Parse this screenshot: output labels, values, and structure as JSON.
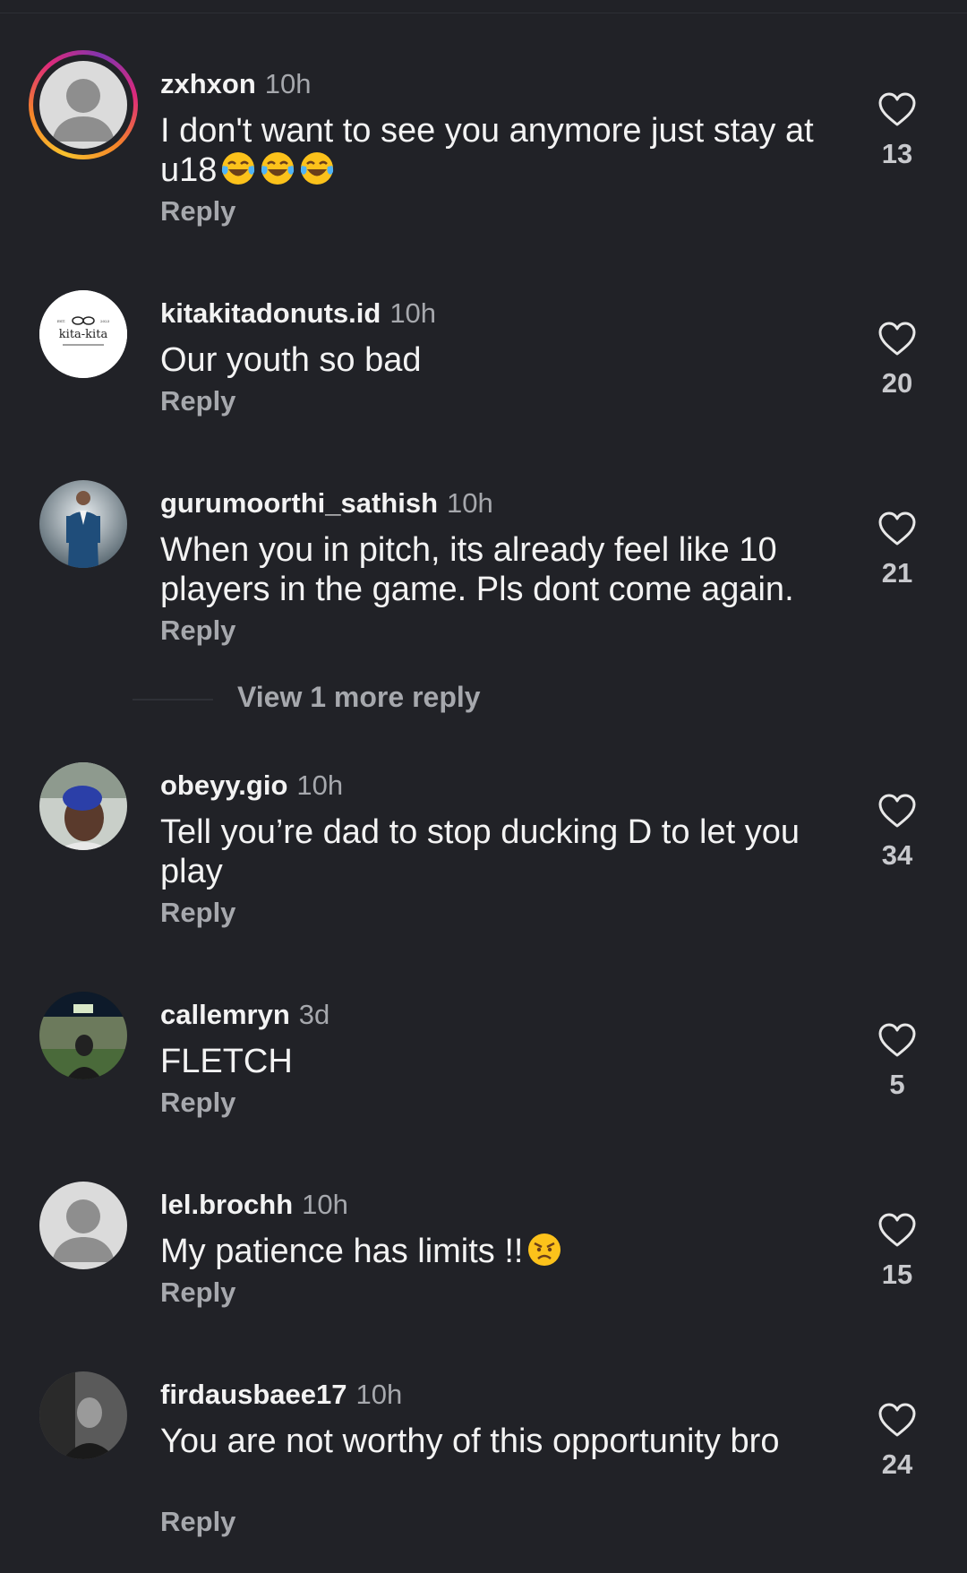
{
  "view_more_label": "View 1 more reply",
  "comments": [
    {
      "username": "zxhxon",
      "time": "10h",
      "text": "I don't want to see you anymore just stay at u18",
      "emoji": [
        "face-with-tears-of-joy",
        "face-with-tears-of-joy",
        "face-with-tears-of-joy"
      ],
      "reply": "Reply",
      "likes": "13",
      "avatar": "default-avatar",
      "story_ring": true
    },
    {
      "username": "kitakitadonuts.id",
      "time": "10h",
      "text": "Our youth so bad",
      "reply": "Reply",
      "likes": "20",
      "avatar": "kita-kita-logo",
      "logo_text": "kita-kita"
    },
    {
      "username": "gurumoorthi_sathish",
      "time": "10h",
      "text": "When you in pitch, its already feel like 10 players in the game. Pls dont come again.",
      "reply": "Reply",
      "likes": "21",
      "avatar": "photo-man-in-suit"
    },
    {
      "username": "obeyy.gio",
      "time": "10h",
      "text": "Tell you’re dad to stop ducking D to let you play",
      "reply": "Reply",
      "likes": "34",
      "avatar": "photo-blue-hair"
    },
    {
      "username": "callemryn",
      "time": "3d",
      "text": "FLETCH",
      "reply": "Reply",
      "likes": "5",
      "avatar": "photo-stadium"
    },
    {
      "username": "lel.brochh",
      "time": "10h",
      "text": "My patience has limits !!",
      "emoji": [
        "angry-face"
      ],
      "reply": "Reply",
      "likes": "15",
      "avatar": "default-avatar"
    },
    {
      "username": "firdausbaee17",
      "time": "10h",
      "text": "You are not worthy of this opportunity bro",
      "reply": "Reply",
      "likes": "24",
      "avatar": "photo-monochrome"
    }
  ],
  "colors": {
    "background": "#212227",
    "text_primary": "#f3f3f3",
    "text_secondary": "#a6a8ad",
    "like_count": "#c8c9cd"
  }
}
